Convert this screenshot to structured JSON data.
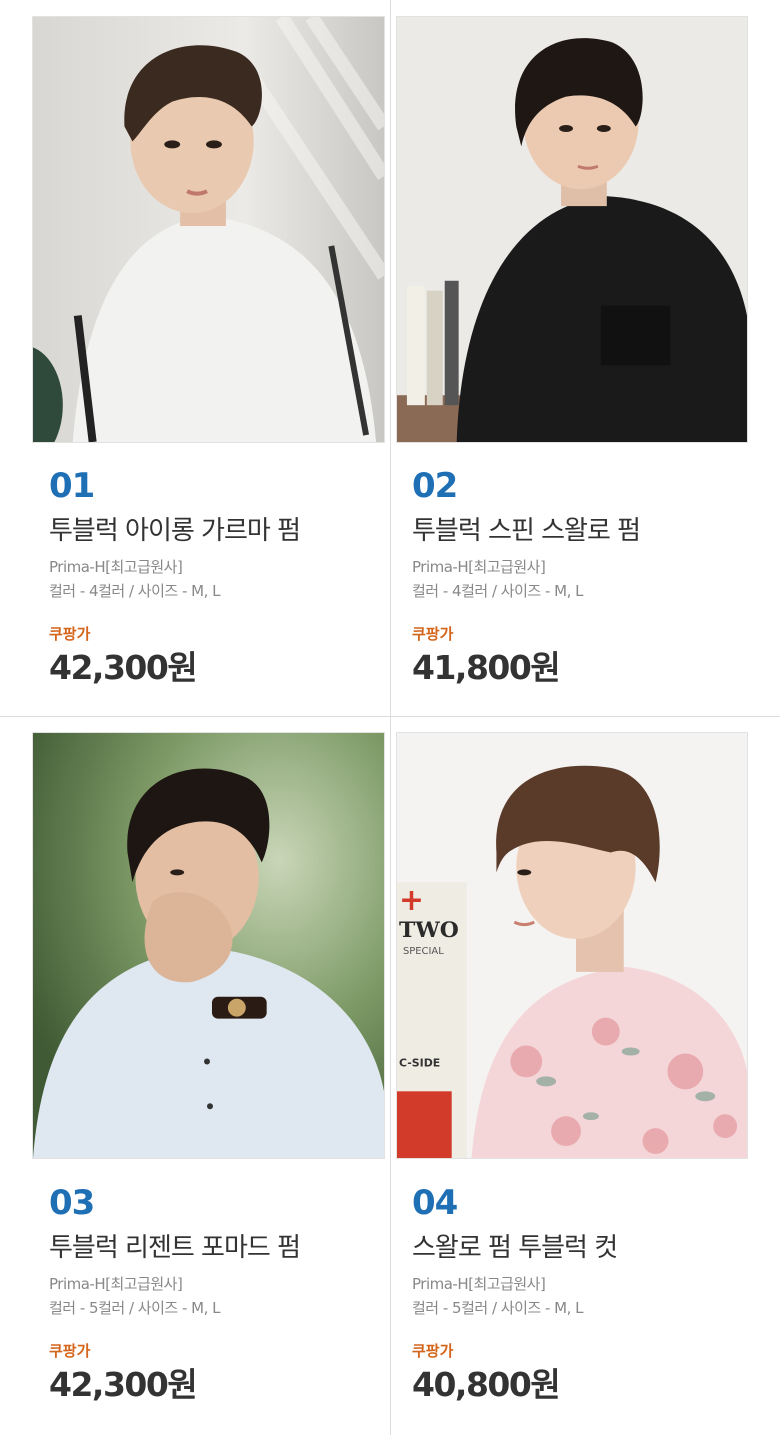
{
  "products": [
    {
      "number": "01",
      "title": "투블럭 아이롱 가르마 펌",
      "brand": "Prima-H[최고급원사]",
      "options": "컬러 - 4컬러 / 사이즈 - M, L",
      "price_label": "쿠팡가",
      "price": "42,300원",
      "image": "model-white-sweatshirt-photo",
      "overlay_text": [],
      "colors": {
        "background": "#e8e6e2",
        "hair": "#3b2a20",
        "clothing": "#f2f2f0",
        "skin": "#e9c9b0"
      }
    },
    {
      "number": "02",
      "title": "투블럭 스핀 스왈로 펌",
      "brand": "Prima-H[최고급원사]",
      "options": "컬러 - 4컬러 / 사이즈 - M, L",
      "price_label": "쿠팡가",
      "price": "41,800원",
      "image": "model-black-tshirt-photo",
      "overlay_text": [],
      "colors": {
        "background": "#ebeae7",
        "hair": "#1f1714",
        "clothing": "#1a1a1a",
        "skin": "#eccab2"
      }
    },
    {
      "number": "03",
      "title": "투블럭 리젠트 포마드 펌",
      "brand": "Prima-H[최고급원사]",
      "options": "컬러 - 5컬러 / 사이즈 - M, L",
      "price_label": "쿠팡가",
      "price": "42,300원",
      "image": "model-light-blue-shirt-photo",
      "overlay_text": [],
      "colors": {
        "background": "#6e8a5a",
        "hair": "#1e1612",
        "clothing": "#dfe8f0",
        "skin": "#e3bea3"
      }
    },
    {
      "number": "04",
      "title": "스왈로 펌 투블럭 컷",
      "brand": "Prima-H[최고급원사]",
      "options": "컬러 - 5컬러 / 사이즈 - M, L",
      "price_label": "쿠팡가",
      "price": "40,800원",
      "image": "model-floral-shirt-photo",
      "overlay_text": [
        "+",
        "TWO",
        "SPECIAL",
        "C-SIDE"
      ],
      "colors": {
        "background": "#f4f3f1",
        "hair": "#5a3a28",
        "clothing": "#f4d6d8",
        "skin": "#efd0bc",
        "accent": "#d23a2a"
      }
    }
  ],
  "colors": {
    "number": "#1f6fb5",
    "price_label": "#d4661c",
    "divider": "#dcdcdc"
  }
}
